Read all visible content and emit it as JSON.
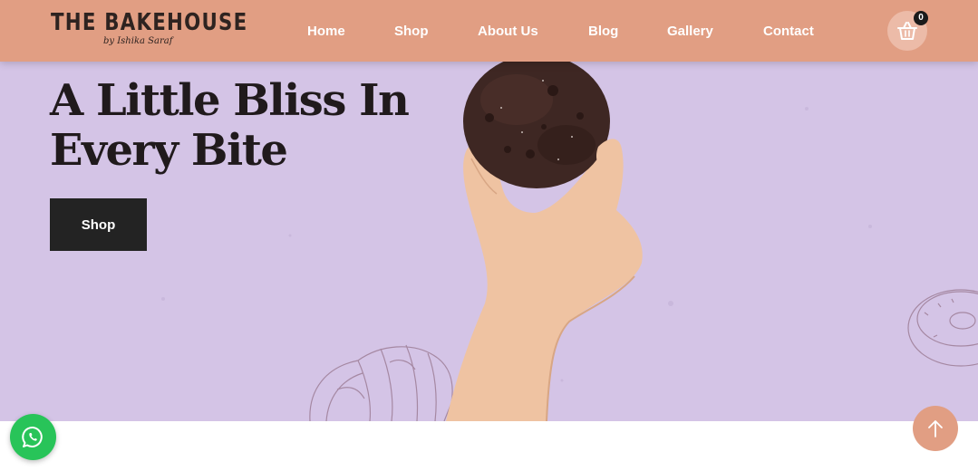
{
  "brand": {
    "name": "THE BAKEHOUSE",
    "tagline": "by Ishika Saraf"
  },
  "nav": {
    "items": [
      {
        "label": "Home"
      },
      {
        "label": "Shop"
      },
      {
        "label": "About Us"
      },
      {
        "label": "Blog"
      },
      {
        "label": "Gallery"
      },
      {
        "label": "Contact"
      }
    ]
  },
  "cart": {
    "icon": "basket-icon",
    "count": "0"
  },
  "hero": {
    "title_line1": "A Little Bliss In",
    "title_line2": "Every Bite",
    "cta_label": "Shop"
  },
  "floating": {
    "whatsapp_icon": "whatsapp-icon",
    "scroll_top_icon": "arrow-up-icon"
  },
  "colors": {
    "header_bg": "#e19e83",
    "hero_bg": "#d4c4e6",
    "button_dark": "#232323",
    "whatsapp_green": "#28c459",
    "accent_peach": "#e19e83"
  }
}
